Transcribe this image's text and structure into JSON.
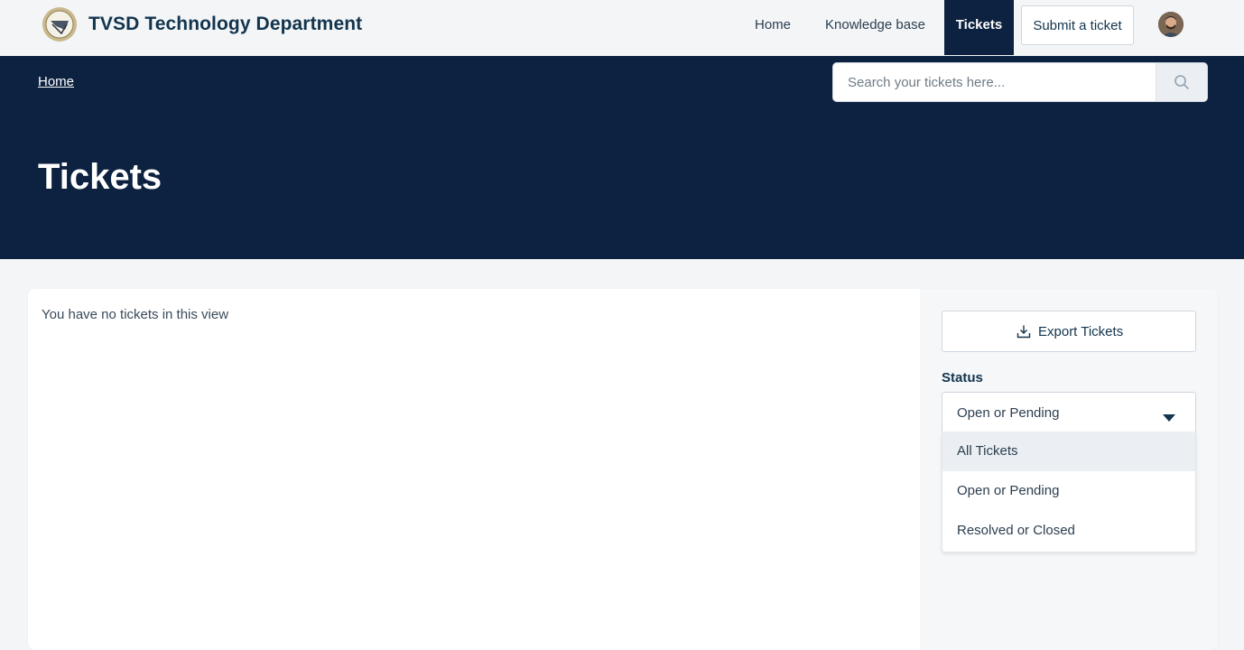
{
  "header": {
    "brand": "TVSD Technology Department",
    "nav": {
      "home": "Home",
      "knowledge_base": "Knowledge base",
      "tickets": "Tickets",
      "submit_ticket": "Submit a ticket"
    },
    "colors": {
      "nav_active_bg": "#0d2240"
    }
  },
  "hero": {
    "breadcrumb": "Home",
    "search_placeholder": "Search your tickets here...",
    "title": "Tickets",
    "background": "#0d2240"
  },
  "main": {
    "empty_message": "You have no tickets in this view"
  },
  "sidebar": {
    "export_label": "Export Tickets",
    "status_label": "Status",
    "status_selected": "Open or Pending",
    "status_options": [
      "All Tickets",
      "Open or Pending",
      "Resolved or Closed"
    ],
    "highlighted_option": "All Tickets"
  },
  "icons": {
    "logo": "tvsd-seal-logo",
    "avatar": "user-avatar",
    "search": "search-icon",
    "export": "download-icon",
    "dropdown": "caret-down-icon"
  }
}
